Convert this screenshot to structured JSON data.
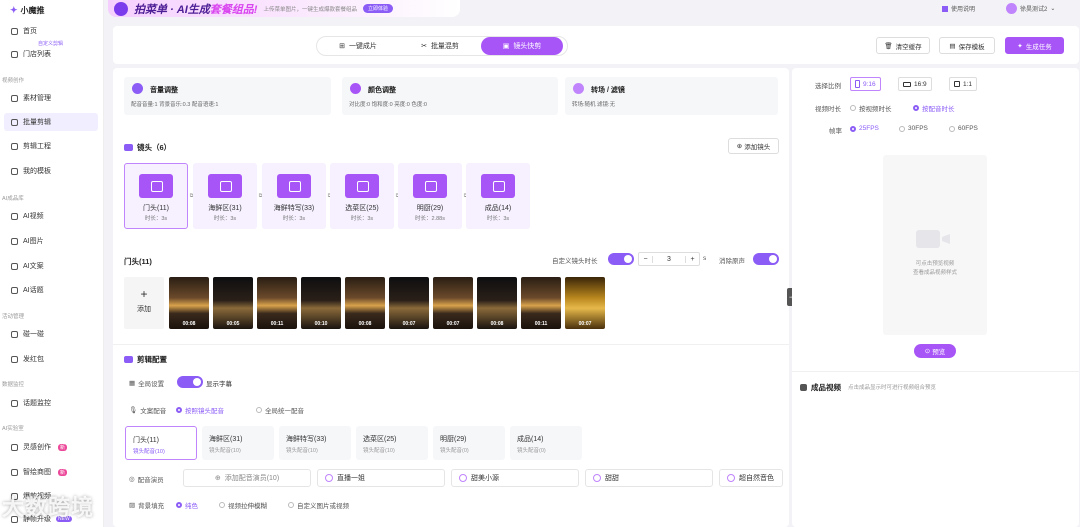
{
  "app": {
    "name": "小魔推"
  },
  "sidebar": {
    "items": [
      {
        "label": "首页"
      },
      {
        "label": "门店列表"
      },
      {
        "label": "素材管理"
      },
      {
        "label": "批量剪辑"
      },
      {
        "label": "剪辑工程"
      },
      {
        "label": "我的模板"
      },
      {
        "label": "AI视频"
      },
      {
        "label": "AI图片"
      },
      {
        "label": "AI文案"
      },
      {
        "label": "AI话题"
      },
      {
        "label": "碰一碰"
      },
      {
        "label": "发红包"
      },
      {
        "label": "话题监控"
      },
      {
        "label": "灵感创作"
      },
      {
        "label": "智绘商图"
      },
      {
        "label": "爆款视频"
      },
      {
        "label": "静帧升级"
      }
    ],
    "groups": {
      "video": "视频创作",
      "ai": "AI成品库",
      "activity": "活动管理",
      "data": "数据监控",
      "lab": "AI实验室"
    },
    "sub_tag": "自定义剪辑",
    "badge_new": "新",
    "badge_new_en": "NEW"
  },
  "banner": {
    "title_a": "拍菜单 · AI生成",
    "title_b": "套餐组品!",
    "sub": "上传菜单图片，一键生成爆款套餐组品",
    "btn": "立即体验"
  },
  "topright": {
    "guide": "使用说明",
    "user": "徐昊测试2"
  },
  "modes": {
    "tabs": [
      "一键成片",
      "批量混剪",
      "镜头快剪"
    ],
    "active": 2
  },
  "toolbar": {
    "clear": "清空缓存",
    "save_tpl": "保存模板",
    "generate": "生成任务"
  },
  "adjust": [
    {
      "title": "音量调整",
      "desc": "配音音量:1 背景音乐:0.3 配音语速:1"
    },
    {
      "title": "颜色调整",
      "desc": "对比度:0 饱和度:0 亮度:0 色度:0"
    },
    {
      "title": "转场 / 滤镜",
      "desc": "转场:随机 滤镜:无"
    }
  ],
  "shots": {
    "title": "镜头（6）",
    "add": "添加镜头",
    "items": [
      {
        "name": "门头(11)",
        "dur": "时长：3s"
      },
      {
        "name": "海鲜区(31)",
        "dur": "时长：3s"
      },
      {
        "name": "海鲜特写(33)",
        "dur": "时长：3s"
      },
      {
        "name": "选菜区(25)",
        "dur": "时长：3s"
      },
      {
        "name": "明厨(29)",
        "dur": "时长：2.88s"
      },
      {
        "name": "成品(14)",
        "dur": "时长：3s"
      }
    ]
  },
  "clips": {
    "title": "门头(11)",
    "custom_dur_label": "自定义镜头时长",
    "dur_value": "3",
    "unit": "s",
    "mute_label": "消除原声",
    "add_label": "添加",
    "add_plus": "+",
    "times": [
      "00:08",
      "00:05",
      "00:11",
      "00:10",
      "00:08",
      "00:07",
      "00:07",
      "00:08",
      "00:11",
      "00:07"
    ]
  },
  "config": {
    "title": "剪辑配置",
    "global": "全局设置",
    "subtitle": "显示字幕",
    "dub_label": "文案配音",
    "dub_opt1": "按照镜头配音",
    "dub_opt2": "全局统一配音",
    "cards": [
      {
        "name": "门头(11)",
        "sub": "镜头配音(10)"
      },
      {
        "name": "海鲜区(31)",
        "sub": "镜头配音(10)"
      },
      {
        "name": "海鲜特写(33)",
        "sub": "镜头配音(10)"
      },
      {
        "name": "选菜区(25)",
        "sub": "镜头配音(10)"
      },
      {
        "name": "明厨(29)",
        "sub": "镜头配音(0)"
      },
      {
        "name": "成品(14)",
        "sub": "镜头配音(0)"
      }
    ],
    "voice_label": "配音演员",
    "voice_add": "添加配音演员(10)",
    "voices": [
      "直播一姐",
      "甜美小源",
      "甜甜",
      "超自然音色"
    ],
    "bg_label": "背景填充",
    "bg_opts": [
      "纯色",
      "视频拉伸模糊",
      "自定义图片或视频"
    ]
  },
  "right": {
    "ratio_label": "选择比例",
    "ratios": [
      "9:16",
      "16:9",
      "1:1"
    ],
    "dur_label": "视频时长",
    "dur_opts": [
      "按视频时长",
      "按配音时长"
    ],
    "fps_label": "帧率",
    "fps_opts": [
      "25FPS",
      "30FPS",
      "60FPS"
    ],
    "preview_hint1": "可点击预览视频",
    "preview_hint2": "查看成品视频样式",
    "preview_btn": "预览",
    "output_title": "成品视频",
    "output_hint": "点击成品显示时可进行视频组合预览"
  },
  "watermark": "大数跨境",
  "colors": {
    "accent": "#a855f7",
    "accent_dark": "#8b5cf6"
  }
}
